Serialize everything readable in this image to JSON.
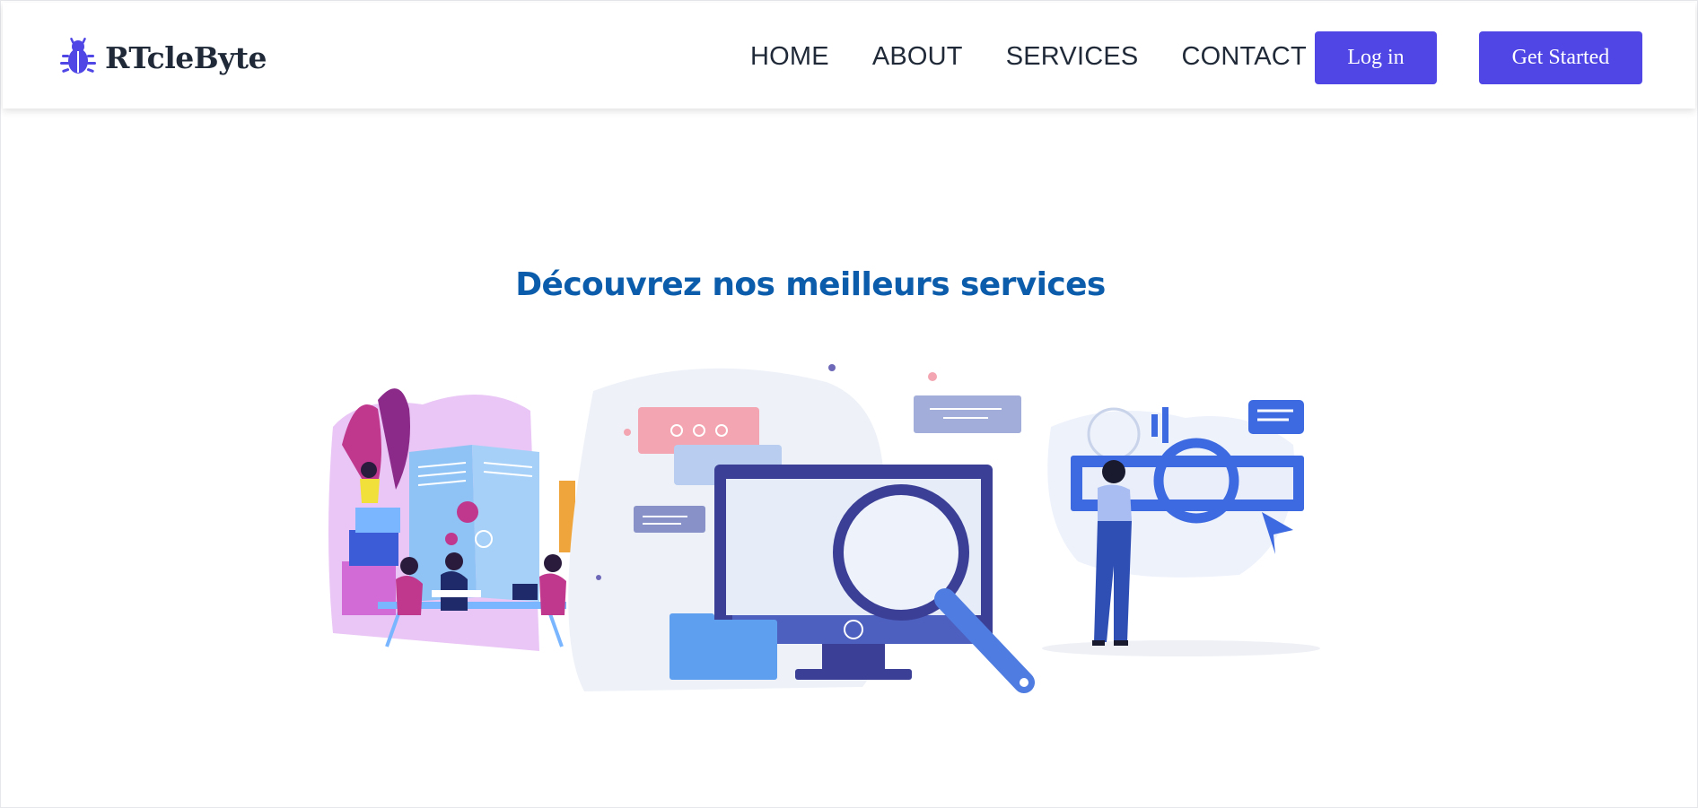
{
  "brand": {
    "name": "RTcleByte",
    "icon": "bug-icon",
    "color": "#4f46e5"
  },
  "nav": {
    "items": [
      {
        "label": "HOME"
      },
      {
        "label": "ABOUT"
      },
      {
        "label": "SERVICES"
      },
      {
        "label": "CONTACT"
      }
    ],
    "login_label": "Log in",
    "get_started_label": "Get Started"
  },
  "hero": {
    "title": "Découvrez nos meilleurs services",
    "title_color": "#0b5cab",
    "illustration": "education-search-services-illustration"
  },
  "colors": {
    "accent": "#4f46e5",
    "text": "#1f2937"
  }
}
